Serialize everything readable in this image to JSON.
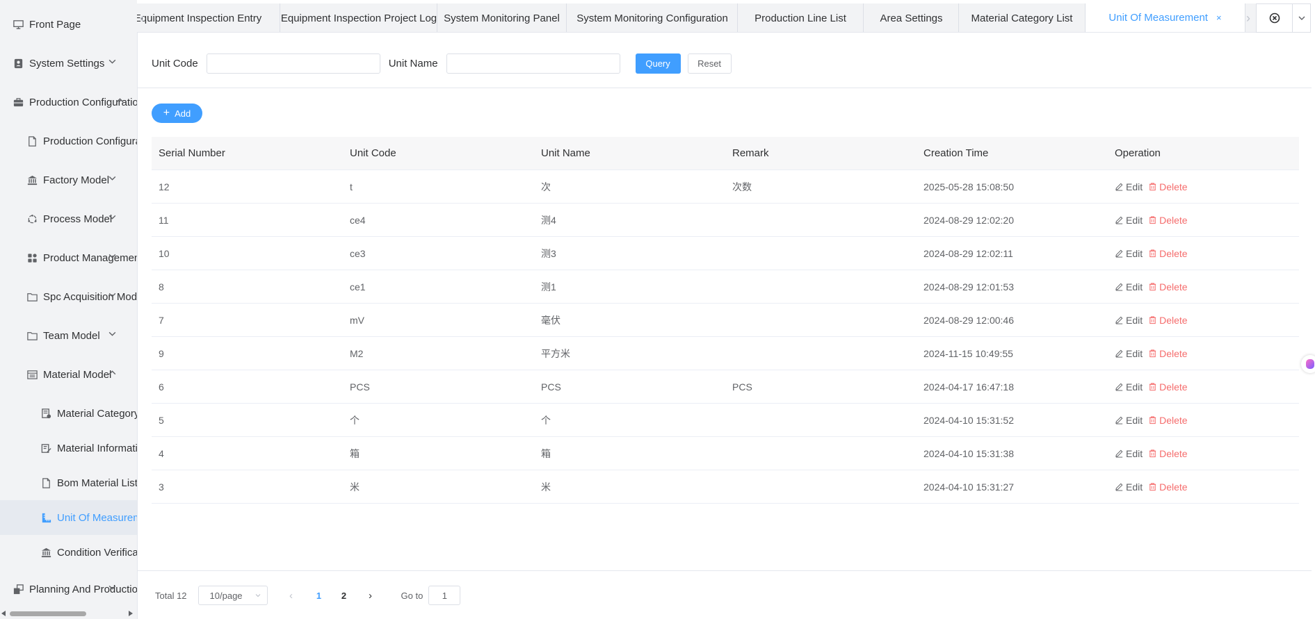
{
  "sidebar": {
    "items": [
      {
        "label": "Front Page",
        "icon": "monitor-icon",
        "level": 0,
        "chevron": ""
      },
      {
        "label": "System Settings",
        "icon": "user-settings-icon",
        "level": 0,
        "chevron": "down"
      },
      {
        "label": "Production Configuration",
        "icon": "briefcase-icon",
        "level": 0,
        "chevron": "up"
      },
      {
        "label": "Production Configuration",
        "icon": "document-icon",
        "level": 1,
        "chevron": ""
      },
      {
        "label": "Factory Model",
        "icon": "bank-icon",
        "level": 1,
        "chevron": "down"
      },
      {
        "label": "Process Model",
        "icon": "cycle-icon",
        "level": 1,
        "chevron": "down"
      },
      {
        "label": "Product Management",
        "icon": "grid-icon",
        "level": 1,
        "chevron": "down"
      },
      {
        "label": "Spc Acquisition Model",
        "icon": "folder-icon",
        "level": 1,
        "chevron": "down"
      },
      {
        "label": "Team Model",
        "icon": "folder-icon",
        "level": 1,
        "chevron": "down"
      },
      {
        "label": "Material Model",
        "icon": "list-icon",
        "level": 1,
        "chevron": "up"
      },
      {
        "label": "Material Category",
        "icon": "category-icon",
        "level": 2,
        "chevron": ""
      },
      {
        "label": "Material Information",
        "icon": "edit-doc-icon",
        "level": 2,
        "chevron": ""
      },
      {
        "label": "Bom Material List",
        "icon": "document-icon",
        "level": 2,
        "chevron": ""
      },
      {
        "label": "Unit Of Measurement",
        "icon": "ruler-icon",
        "level": 2,
        "chevron": "",
        "active": true
      },
      {
        "label": "Condition Verification",
        "icon": "bank-icon",
        "level": 2,
        "chevron": ""
      },
      {
        "label": "Planning And Production",
        "icon": "windows-icon",
        "level": 0,
        "chevron": "down"
      }
    ]
  },
  "tabs": [
    {
      "label": "Equipment Inspection Entry"
    },
    {
      "label": "Equipment Inspection Project Log"
    },
    {
      "label": "System Monitoring Panel"
    },
    {
      "label": "System Monitoring Configuration"
    },
    {
      "label": "Production Line List"
    },
    {
      "label": "Area Settings"
    },
    {
      "label": "Material Category List"
    },
    {
      "label": "Unit Of Measurement",
      "active": true,
      "close": "×"
    }
  ],
  "query": {
    "unit_code_label": "Unit Code",
    "unit_code_value": "",
    "unit_name_label": "Unit Name",
    "unit_name_value": "",
    "query_label": "Query",
    "reset_label": "Reset"
  },
  "toolbar": {
    "add_label": "Add"
  },
  "table": {
    "headers": [
      "Serial Number",
      "Unit Code",
      "Unit Name",
      "Remark",
      "Creation Time",
      "Operation"
    ],
    "edit_label": "Edit",
    "delete_label": "Delete",
    "rows": [
      {
        "serial": "12",
        "code": "t",
        "name": "次",
        "remark": "次数",
        "time": "2025-05-28 15:08:50"
      },
      {
        "serial": "11",
        "code": "ce4",
        "name": "测4",
        "remark": "",
        "time": "2024-08-29 12:02:20"
      },
      {
        "serial": "10",
        "code": "ce3",
        "name": "测3",
        "remark": "",
        "time": "2024-08-29 12:02:11"
      },
      {
        "serial": "8",
        "code": "ce1",
        "name": "测1",
        "remark": "",
        "time": "2024-08-29 12:01:53"
      },
      {
        "serial": "7",
        "code": "mV",
        "name": "毫伏",
        "remark": "",
        "time": "2024-08-29 12:00:46"
      },
      {
        "serial": "9",
        "code": "M2",
        "name": "平方米",
        "remark": "",
        "time": "2024-11-15 10:49:55"
      },
      {
        "serial": "6",
        "code": "PCS",
        "name": "PCS",
        "remark": "PCS",
        "time": "2024-04-17 16:47:18"
      },
      {
        "serial": "5",
        "code": "个",
        "name": "个",
        "remark": "",
        "time": "2024-04-10 15:31:52"
      },
      {
        "serial": "4",
        "code": "箱",
        "name": "箱",
        "remark": "",
        "time": "2024-04-10 15:31:38"
      },
      {
        "serial": "3",
        "code": "米",
        "name": "米",
        "remark": "",
        "time": "2024-04-10 15:31:27"
      }
    ]
  },
  "pagination": {
    "total_label": "Total 12",
    "page_size": "10/page",
    "pages": [
      "1",
      "2"
    ],
    "current": "1",
    "goto_label": "Go to",
    "goto_value": "1"
  },
  "colors": {
    "primary": "#409eff",
    "danger": "#f56c6c",
    "sidebar_bg": "#f2f3f5"
  }
}
